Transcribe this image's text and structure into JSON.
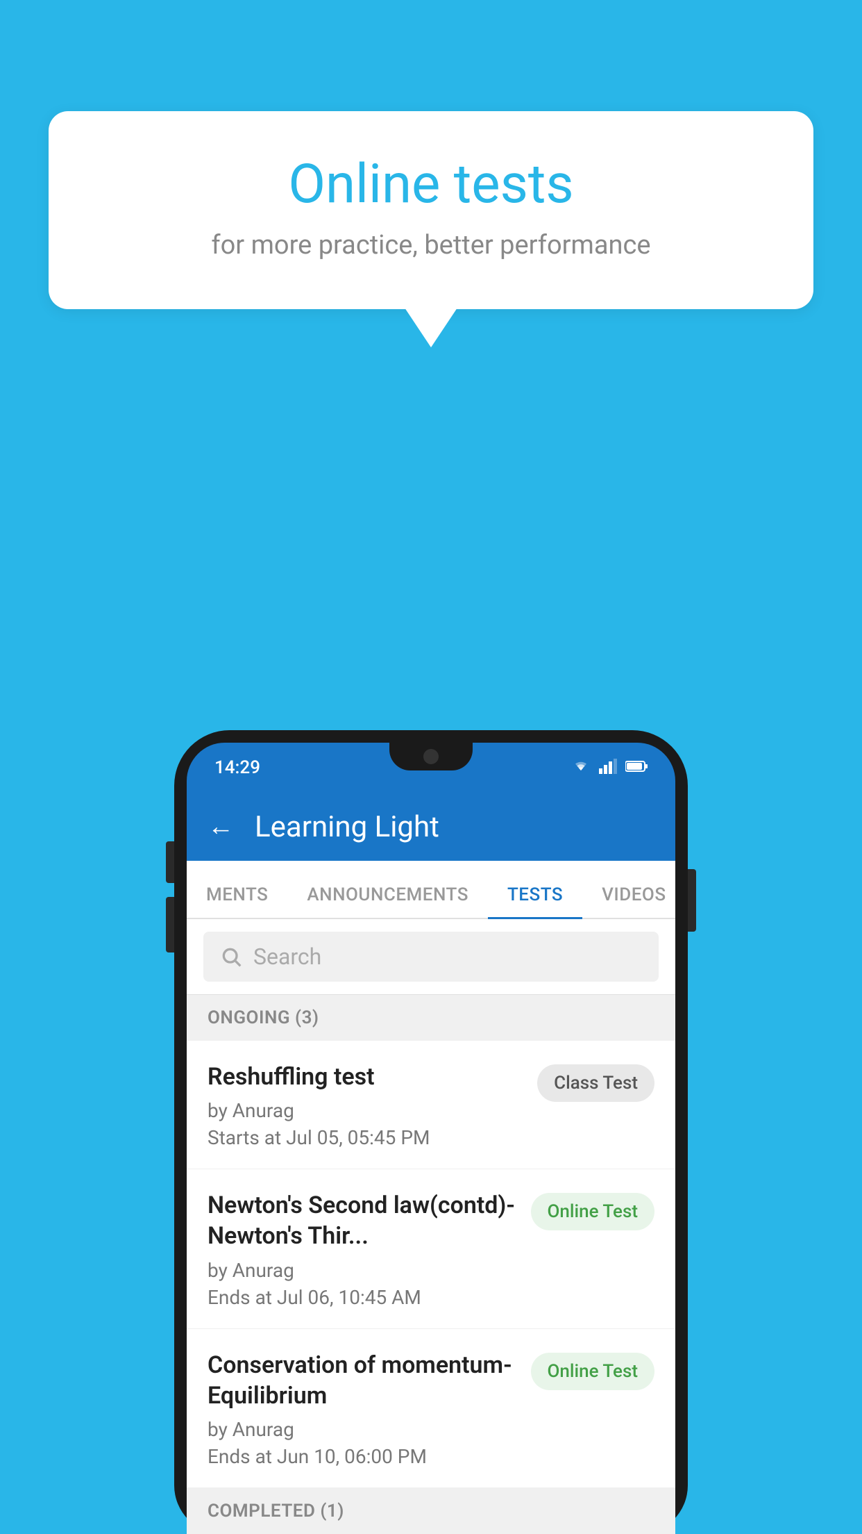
{
  "background_color": "#29b6e8",
  "bubble": {
    "title": "Online tests",
    "subtitle": "for more practice, better performance"
  },
  "phone": {
    "status_bar": {
      "time": "14:29",
      "icons": [
        "wifi",
        "signal",
        "battery"
      ]
    },
    "header": {
      "title": "Learning Light",
      "back_label": "←"
    },
    "tabs": [
      {
        "label": "MENTS",
        "active": false
      },
      {
        "label": "ANNOUNCEMENTS",
        "active": false
      },
      {
        "label": "TESTS",
        "active": true
      },
      {
        "label": "VIDEOS",
        "active": false
      }
    ],
    "search": {
      "placeholder": "Search"
    },
    "ongoing_section": {
      "title": "ONGOING (3)"
    },
    "tests": [
      {
        "name": "Reshuffling test",
        "by": "by Anurag",
        "date": "Starts at  Jul 05, 05:45 PM",
        "badge": "Class Test",
        "badge_type": "class"
      },
      {
        "name": "Newton's Second law(contd)-Newton's Thir...",
        "by": "by Anurag",
        "date": "Ends at  Jul 06, 10:45 AM",
        "badge": "Online Test",
        "badge_type": "online"
      },
      {
        "name": "Conservation of momentum-Equilibrium",
        "by": "by Anurag",
        "date": "Ends at  Jun 10, 06:00 PM",
        "badge": "Online Test",
        "badge_type": "online"
      }
    ],
    "completed_section": {
      "title": "COMPLETED (1)"
    }
  }
}
